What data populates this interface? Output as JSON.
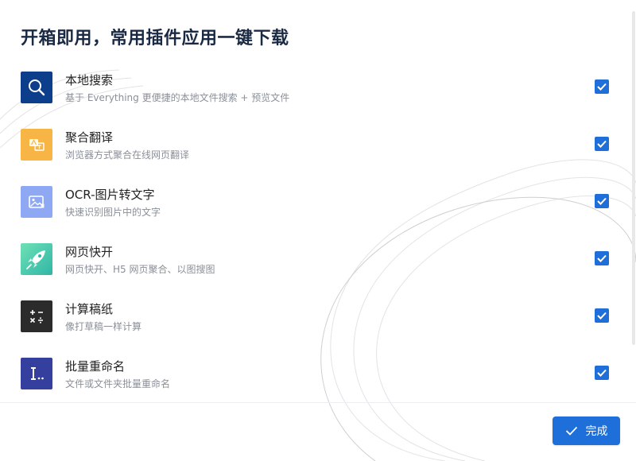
{
  "header": {
    "title": "开箱即用，常用插件应用一键下载"
  },
  "plugins": [
    {
      "name": "本地搜索",
      "desc": "基于 Everything 更便捷的本地文件搜索 + 预览文件",
      "icon": "search-icon",
      "color": "#0c3e8c",
      "checked": true
    },
    {
      "name": "聚合翻译",
      "desc": "浏览器方式聚合在线网页翻译",
      "icon": "translate-icon",
      "color": "#f7b545",
      "checked": true
    },
    {
      "name": "OCR-图片转文字",
      "desc": "快速识别图片中的文字",
      "icon": "image-icon",
      "color": "#8fa8f4",
      "checked": true
    },
    {
      "name": "网页快开",
      "desc": "网页快开、H5 网页聚合、以图搜图",
      "icon": "rocket-icon",
      "color": "#47c6a3",
      "checked": true
    },
    {
      "name": "计算稿纸",
      "desc": "像打草稿一样计算",
      "icon": "calculator-icon",
      "color": "#2b2b2b",
      "checked": true
    },
    {
      "name": "批量重命名",
      "desc": "文件或文件夹批量重命名",
      "icon": "rename-icon",
      "color": "#343f9e",
      "checked": true
    }
  ],
  "footer": {
    "done_label": "完成"
  },
  "colors": {
    "accent": "#1e6fd9",
    "title": "#1b2a44"
  }
}
